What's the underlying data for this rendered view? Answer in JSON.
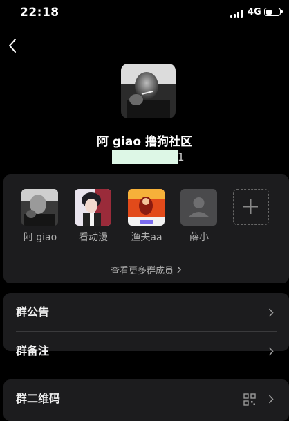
{
  "status_bar": {
    "time": "22:18",
    "network": "4G",
    "battery_level": 0.45
  },
  "group": {
    "name": "阿 giao 撸狗社区",
    "id_visible": "1"
  },
  "members": [
    {
      "name": "阿 giao"
    },
    {
      "name": "看动漫"
    },
    {
      "name": "渔夫aa"
    },
    {
      "name": "薛小"
    }
  ],
  "members_panel": {
    "view_more": "查看更多群成员"
  },
  "settings": {
    "announcement": "群公告",
    "remark": "群备注",
    "qr_code": "群二维码"
  },
  "icons": {
    "back": "chevron-left-icon",
    "add": "plus-icon",
    "chevron": "chevron-right-icon",
    "qr": "qr-code-icon"
  },
  "colors": {
    "background": "#000000",
    "card": "#1c1c1e",
    "id_mask": "#ddf7e6"
  }
}
